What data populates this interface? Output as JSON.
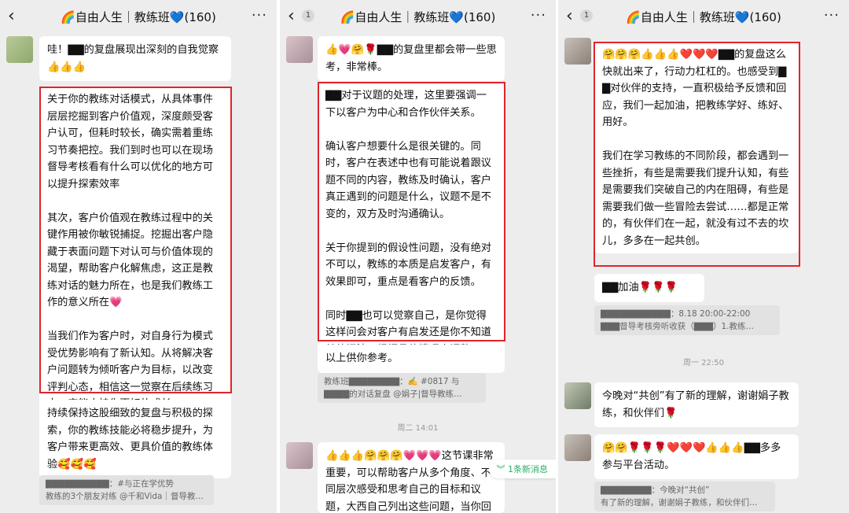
{
  "header": {
    "title": "🌈自由人生｜教练班💙(160)",
    "back_badge": "1",
    "more_label": "···"
  },
  "panel1": {
    "msg_intro": "哇！▇▇的复盘展现出深刻的自我觉察👍👍👍",
    "msg_main": "关于你的教练对话模式，从具体事件层层挖掘到客户价值观，深度颇受客户认可，但耗时较长，确实需着重练习节奏把控。我们到时也可以在现场督导考核看有什么可以优化的地方可以提升探索效率\n\n其次，客户价值观在教练过程中的关键作用被你敏锐捕捉。挖掘出客户隐藏于表面问题下对认可与价值体现的渴望，帮助客户化解焦虑，这正是教练对话的魅力所在，也是我们教练工作的意义所在💗\n\n当我们作为客户时，对自身行为模式受优势影响有了新认知。从将解决客户问题转为倾听客户为目标，以改变评判心态，相信这一觉察在后续练习中一定能支持你更好的成长。",
    "msg_follow": "持续保持这股细致的复盘与积极的探索，你的教练技能必将稳步提升，为客户带来更高效、更具价值的教练体验🥰🥰🥰",
    "quote": "▇▇▇▇▇▇▇▇▇▇：#与正在学优势\n教练的3个朋友对练 @千和Vida｜督导教…"
  },
  "panel2": {
    "msg_top": "👍💗🤗🌹▇▇的复盘里都会带一些思考，非常棒。",
    "msg_main": "▇▇对于议题的处理，这里要强调一下以客户为中心和合作伙伴关系。\n\n确认客户想要什么是很关键的。同时，客户在表述中也有可能说着跟议题不同的内容，教练及时确认，客户真正遇到的问题是什么，议题不是不变的，双方及时沟通确认。\n\n关于你提到的假设性问题，没有绝对不可以，教练的本质是启发客户，有效果即可，重点是看客户的反馈。\n\n同时▇▇也可以觉察自己，是你觉得这样问会对客户有启发还是你不知道其他问法，根据具体情况来调整。",
    "msg_end": "以上供你参考。",
    "quote": "教练班▇▇▇▇▇▇▇▇：✍️ #0817 与\n▇▇▇▇的对话复盘 @娟子|督导教练…",
    "time": "周二 14:01",
    "msg_bottom": "👍👍👍🤗🤗🤗💗💗💗这节课非常重要，可以帮助客户从多个角度、不同层次感受和思考自己的目标和议题，大西自己列出这些问题，当你回答完",
    "new_msg": "︾ 1条新消息"
  },
  "panel3": {
    "msg_main": "🤗🤗🤗👍👍👍❤️❤️❤️▇▇的复盘这么快就出来了，行动力杠杠的。也感受到▇▇对伙伴的支持，一直积极给予反馈和回应，我们一起加油，把教练学好、练好、用好。\n\n我们在学习教练的不同阶段，都会遇到一些挫折，有些是需要我们提升认知，有些是需要我们突破自己的内在阻碍，有些是需要我们做一些冒险去尝试……都是正常的，有伙伴们在一起，就没有过不去的坎儿，多多在一起共创。",
    "msg_cheer": "▇▇加油🌹🌹🌹",
    "quote": "▇▇▇▇▇▇▇▇▇▇▇：8.18 20:00-22:00\n▇▇▇督导考核旁听收获（▇▇▇）1.教练…",
    "time": "周一 22:50",
    "msg_a": "今晚对“共创”有了新的理解，谢谢娟子教练，和伙伴们🌹",
    "msg_b": "🤗🤗🌹🌹🌹❤️❤️❤️👍👍👍▇▇多多参与平台活动。",
    "quote2": "▇▇▇▇▇▇▇▇：今晚对“共创”\n有了新的理解，谢谢娟子教练，和伙伴们…"
  }
}
